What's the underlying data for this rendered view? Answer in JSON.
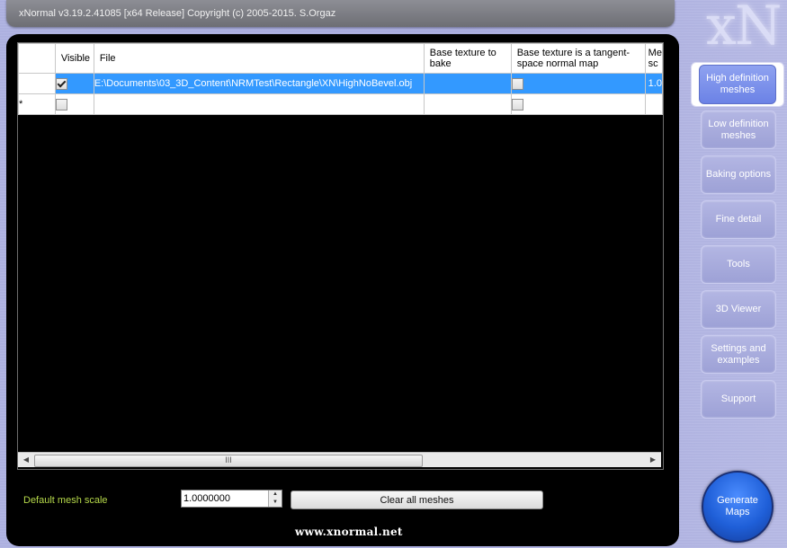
{
  "window": {
    "title": "xNormal v3.19.2.41085 [x64 Release] Copyright (c) 2005-2015. S.Orgaz",
    "logo_text": "xN"
  },
  "grid": {
    "columns": [
      "Visible",
      "File",
      "Base texture to bake",
      "Base texture is a tangent-space normal map",
      "Me sc"
    ],
    "rows": [
      {
        "row_marker": "▶",
        "visible": true,
        "file": "E:\\Documents\\03_3D_Content\\NRMTest\\Rectangle\\XN\\HighNoBevel.obj",
        "base_texture": "",
        "tangent_space": false,
        "mesh_scale": "1.0"
      },
      {
        "row_marker": "*",
        "visible": false,
        "file": "",
        "base_texture": "",
        "tangent_space": false,
        "mesh_scale": ""
      }
    ],
    "scrollbar_thumb": "III"
  },
  "controls": {
    "default_mesh_scale_label": "Default mesh scale",
    "default_mesh_scale_value": "1.0000000",
    "clear_all_label": "Clear all meshes"
  },
  "footer": {
    "url": "www.xnormal.net"
  },
  "nav": [
    {
      "label": "High definition meshes",
      "active": true
    },
    {
      "label": "Low definition meshes",
      "active": false
    },
    {
      "label": "Baking options",
      "active": false
    },
    {
      "label": "Fine detail",
      "active": false
    },
    {
      "label": "Tools",
      "active": false
    },
    {
      "label": "3D Viewer",
      "active": false
    },
    {
      "label": "Settings and examples",
      "active": false
    },
    {
      "label": "Support",
      "active": false
    }
  ],
  "generate": {
    "label": "Generate Maps"
  },
  "colors": {
    "accent": "#3399ff",
    "label_green": "#b6d94a",
    "generate_blue": "#1f5fd8"
  }
}
